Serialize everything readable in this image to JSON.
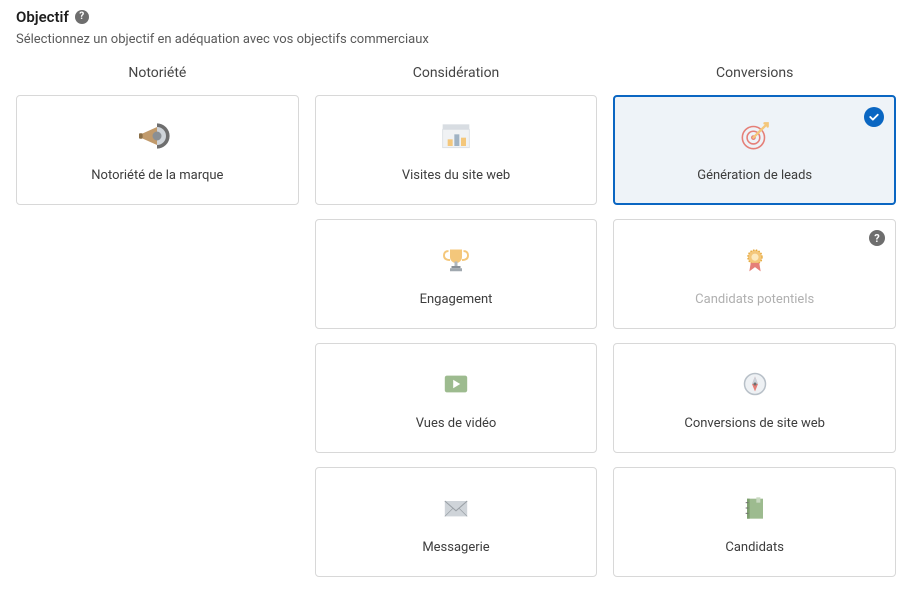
{
  "heading": "Objectif",
  "subtitle": "Sélectionnez un objectif en adéquation avec vos objectifs commerciaux",
  "columns": {
    "awareness": {
      "header": "Notoriété"
    },
    "consideration": {
      "header": "Considération"
    },
    "conversions": {
      "header": "Conversions"
    }
  },
  "cards": {
    "brand_awareness": "Notoriété de la marque",
    "website_visits": "Visites du site web",
    "engagement": "Engagement",
    "video_views": "Vues de vidéo",
    "messaging": "Messagerie",
    "lead_generation": "Génération de leads",
    "talent_leads": "Candidats potentiels",
    "website_conversions": "Conversions de site web",
    "job_applicants": "Candidats"
  }
}
